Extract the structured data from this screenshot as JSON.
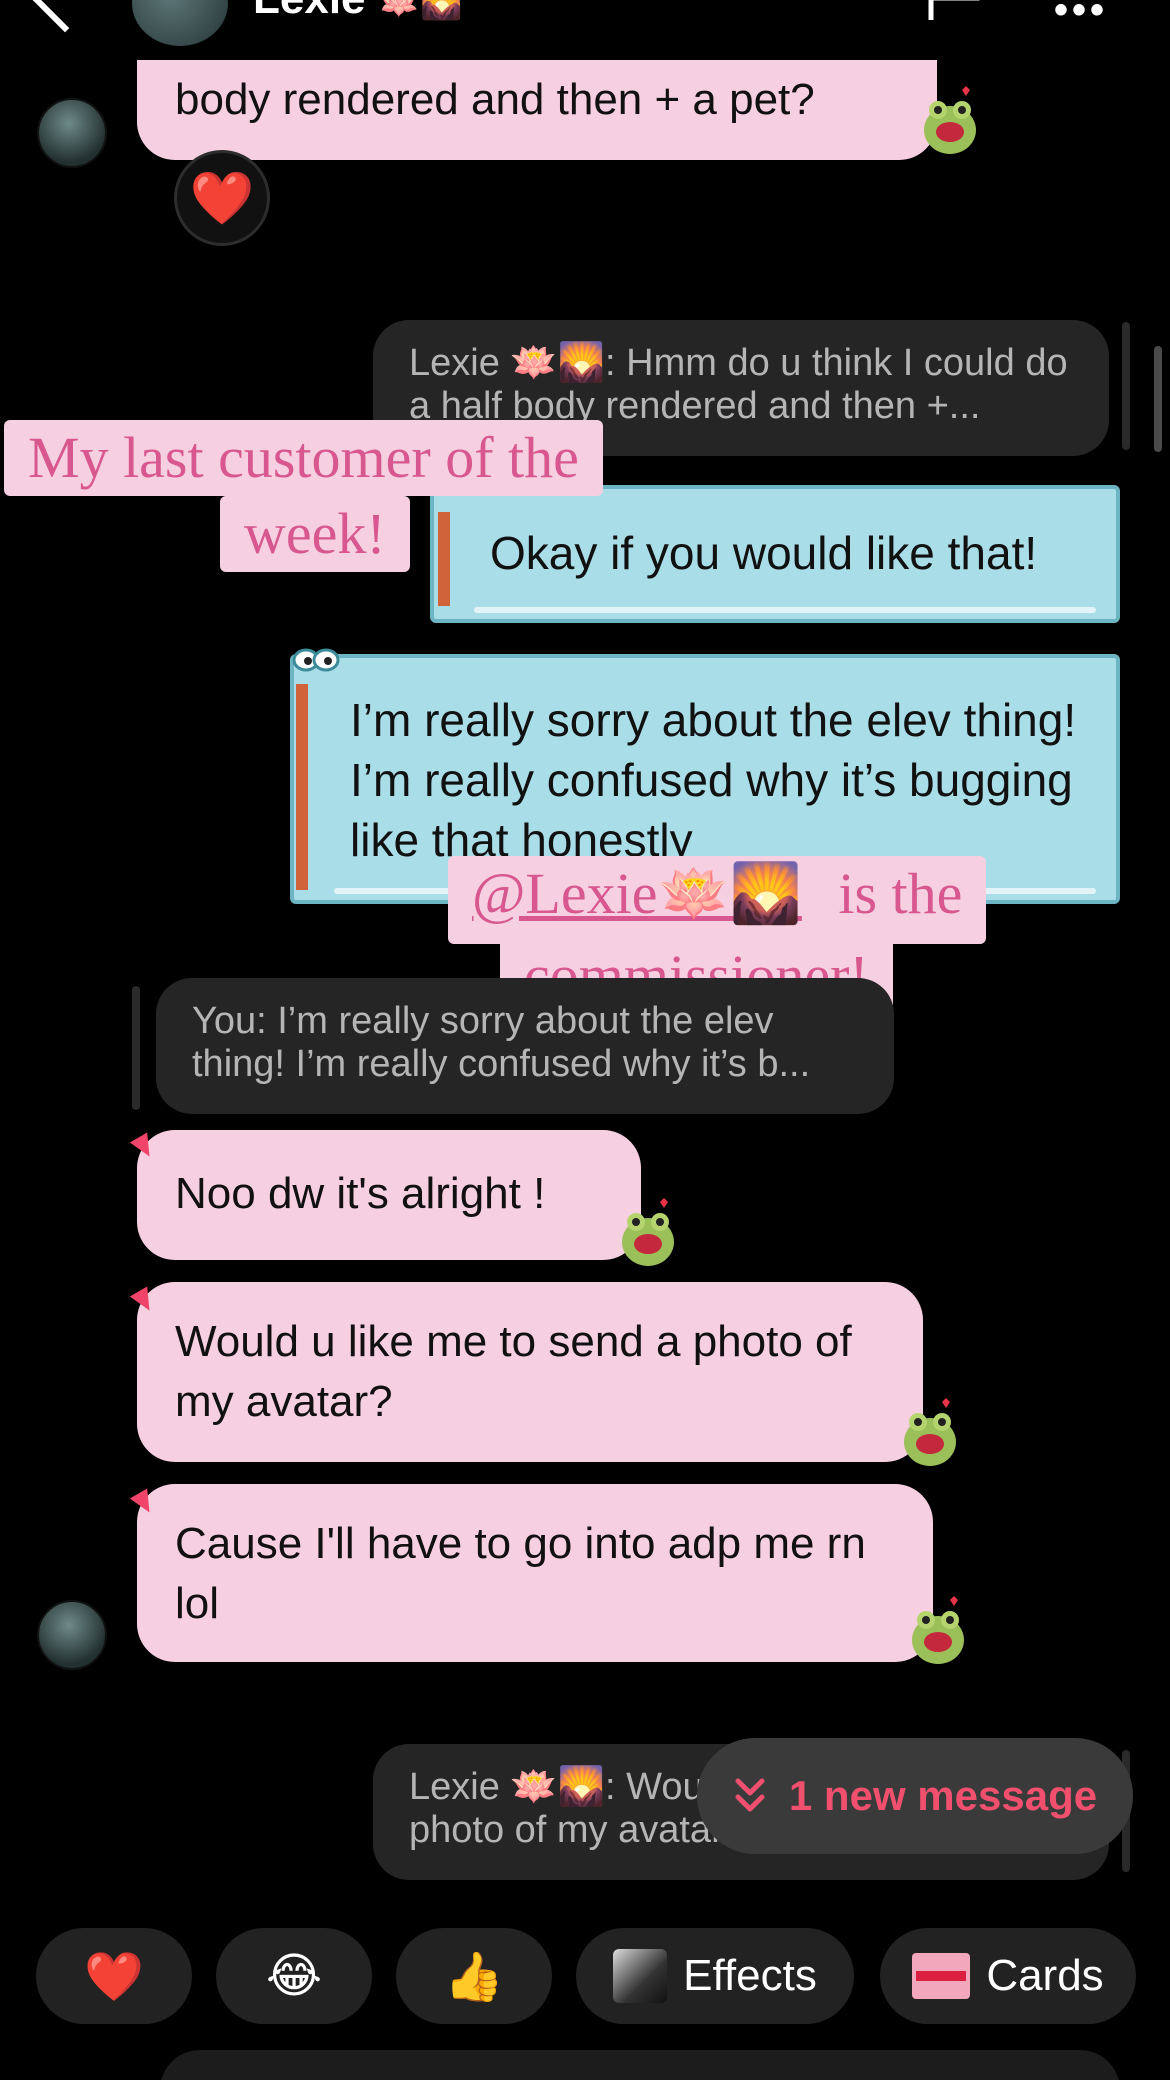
{
  "header": {
    "contact_name": "Lexie",
    "name_emoji": "🪷🌄"
  },
  "messages": {
    "m1_text": "body rendered and then + a pet?",
    "m1_reaction": "❤️",
    "reply1_text": "Lexie 🪷🌄: Hmm do u think I could do a half body rendered and then +...",
    "me1_text": "Okay if you would like that!",
    "me2_text": "I’m really sorry about the elev thing! I’m really confused why it’s bugging like that honestly",
    "reply2_text": "You: I’m really sorry about the elev thing! I’m really confused why it’s b...",
    "m2_text": "Noo dw it's alright !",
    "m3_text": "Would u like me to send a photo of my avatar?",
    "m4_text": "Cause I'll have to go into adp me rn lol",
    "reply3_text": "Lexie 🪷🌄: Would u like me to send a photo of my avatar?"
  },
  "stickers": {
    "s1_line1": "My last customer of the",
    "s1_line2": "week!",
    "s2_mention": "@Lexie🪷🌄",
    "s2_line1_rest": "is the",
    "s2_line2": "commissioner!"
  },
  "new_message_pill": {
    "label": "1 new message"
  },
  "quick_reactions": [
    {
      "icon": "❤️"
    },
    {
      "icon": "😂"
    },
    {
      "icon": "👍"
    },
    {
      "label": "Effects"
    },
    {
      "label": "Cards"
    }
  ],
  "colors": {
    "pink_bubble": "#f6cfe0",
    "blue_bubble": "#a9dde7",
    "accent": "#f0506e",
    "sticker_text": "#d7578e"
  }
}
